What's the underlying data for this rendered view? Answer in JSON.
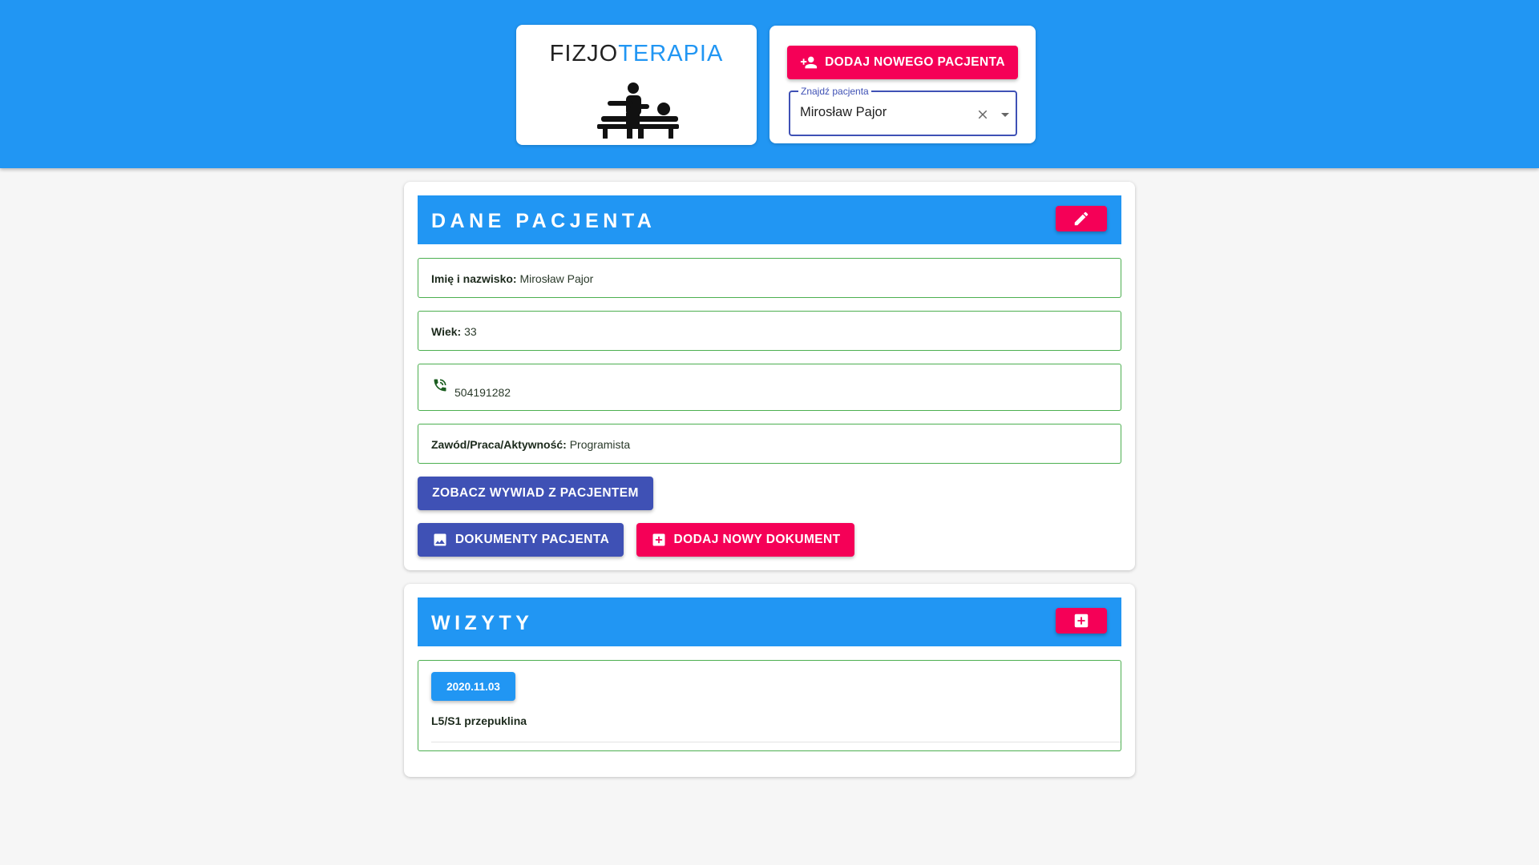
{
  "header": {
    "logo": {
      "text_dark": "FIZJO",
      "text_accent": "TERAPIA",
      "image_icon": "massage-therapist-icon"
    },
    "add_patient_label": "Dodaj nowego pacjenta",
    "add_patient_icon": "person-add-icon",
    "search": {
      "label": "Znajdź pacjenta",
      "value": "Mirosław Pajor"
    }
  },
  "patient": {
    "title": "DANE PACJENTA",
    "edit_icon": "edit-icon",
    "name_label": "Imię i nazwisko:",
    "name_value": "Mirosław Pajor",
    "age_label": "Wiek:",
    "age_value": "33",
    "phone_icon": "phone-icon",
    "phone_value": "504191282",
    "job_label": "Zawód/Praca/Aktywność:",
    "job_value": "Programista",
    "interview_button": "Zobacz wywiad z pacjentem",
    "documents_button": "Dokumenty pacjenta",
    "new_document_button": "Dodaj nowy dokument"
  },
  "visits": {
    "title": "WIZYTY",
    "add_icon": "add-box-icon",
    "items": [
      {
        "date": "2020.11.03",
        "description": "L5/S1 przepuklina"
      }
    ]
  },
  "colors": {
    "primary": "#2196f3",
    "secondary": "#f50057",
    "indigo": "#3f51b5",
    "border_green": "#4caf50"
  }
}
